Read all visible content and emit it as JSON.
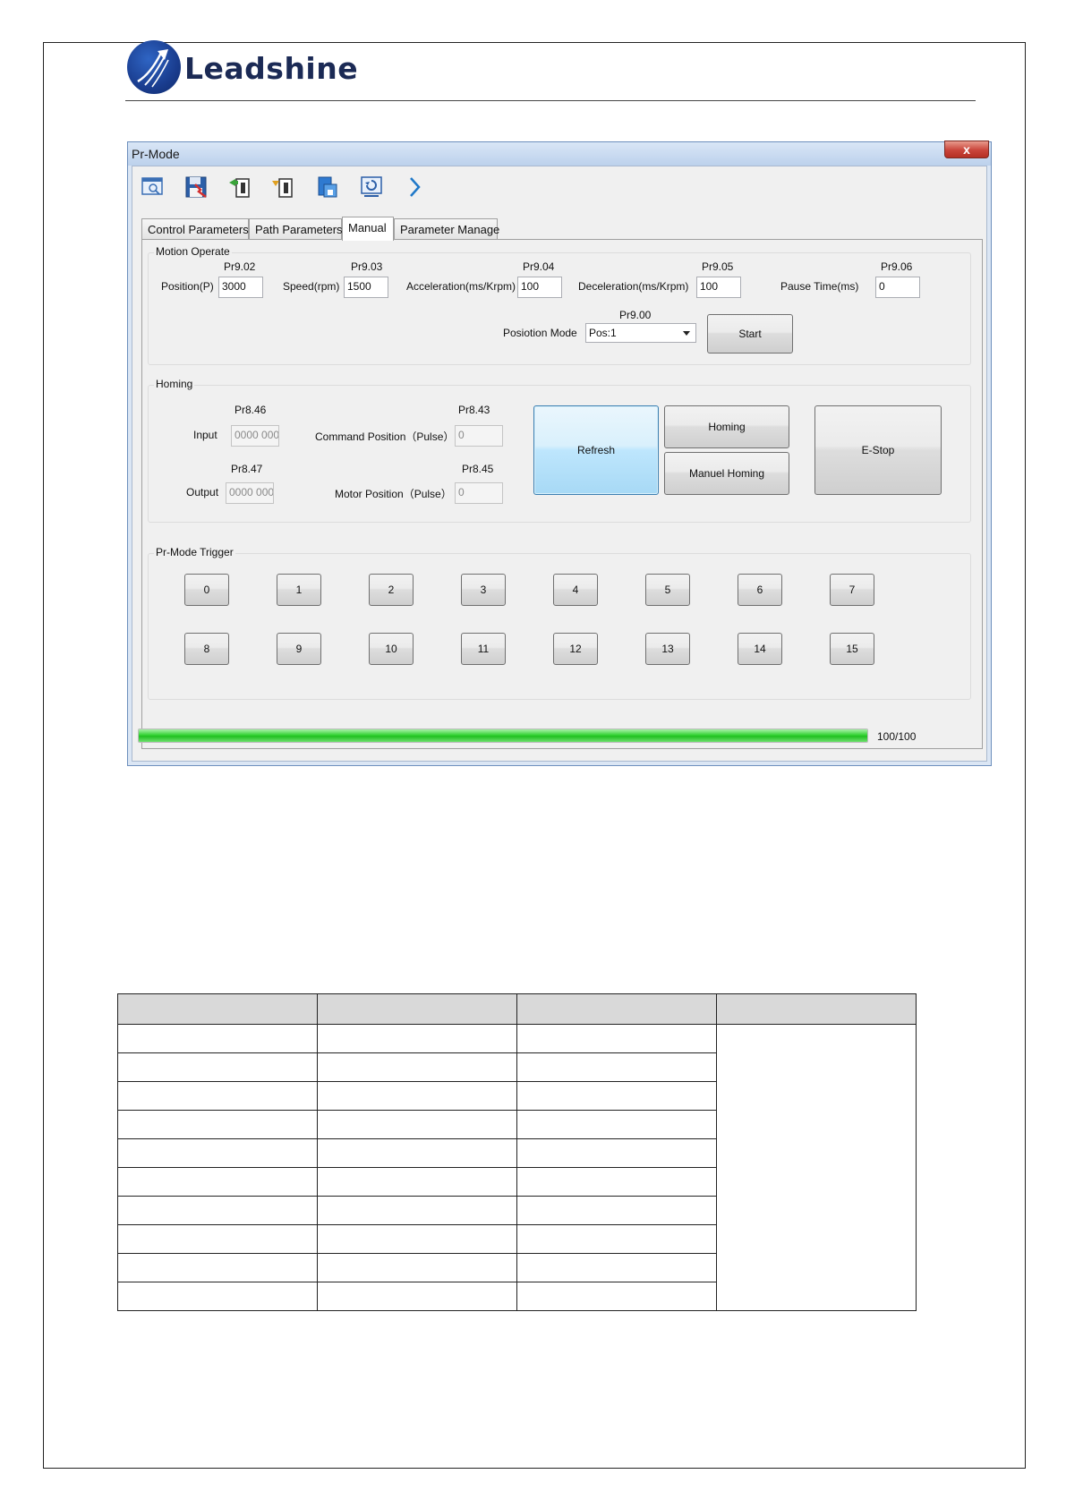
{
  "header": {
    "brand": "Leadshine"
  },
  "window": {
    "title": "Pr-Mode",
    "close_glyph": "x",
    "toolbar": [
      {
        "icon": "open-file-icon"
      },
      {
        "icon": "save-icon"
      },
      {
        "icon": "upload-icon"
      },
      {
        "icon": "download-icon"
      },
      {
        "icon": "write-eeprom-icon"
      },
      {
        "icon": "restore-icon"
      },
      {
        "icon": "next-arrow-icon"
      }
    ],
    "tabs": [
      "Control Parameters",
      "Path Parameters",
      "Manual",
      "Parameter Manage"
    ],
    "active_tab": "Manual",
    "motion": {
      "title": "Motion Operate",
      "position": {
        "param": "Pr9.02",
        "label": "Position(P)",
        "value": "3000"
      },
      "speed": {
        "param": "Pr9.03",
        "label": "Speed(rpm)",
        "value": "1500"
      },
      "accel": {
        "param": "Pr9.04",
        "label": "Acceleration(ms/Krpm)",
        "value": "100"
      },
      "decel": {
        "param": "Pr9.05",
        "label": "Deceleration(ms/Krpm)",
        "value": "100"
      },
      "pause": {
        "param": "Pr9.06",
        "label": "Pause Time(ms)",
        "value": "0"
      },
      "mode": {
        "param": "Pr9.00",
        "label": "Posiotion Mode",
        "value": "Pos:1"
      },
      "start_label": "Start"
    },
    "homing": {
      "title": "Homing",
      "input": {
        "param": "Pr8.46",
        "label": "Input",
        "value": "0000 000"
      },
      "output": {
        "param": "Pr8.47",
        "label": "Output",
        "value": "0000 000"
      },
      "cmd_pos": {
        "param": "Pr8.43",
        "label": "Command Position（Pulse）",
        "value": "0"
      },
      "motor_pos": {
        "param": "Pr8.45",
        "label": "Motor Position（Pulse）",
        "value": "0"
      },
      "refresh_label": "Refresh",
      "homing_label": "Homing",
      "manual_homing_label": "Manuel Homing",
      "estop_label": "E-Stop"
    },
    "trigger": {
      "title": "Pr-Mode Trigger",
      "row1": [
        "0",
        "1",
        "2",
        "3",
        "4",
        "5",
        "6",
        "7"
      ],
      "row2": [
        "8",
        "9",
        "10",
        "11",
        "12",
        "13",
        "14",
        "15"
      ]
    },
    "progress": {
      "value": 1.0,
      "text": "100/100"
    }
  }
}
